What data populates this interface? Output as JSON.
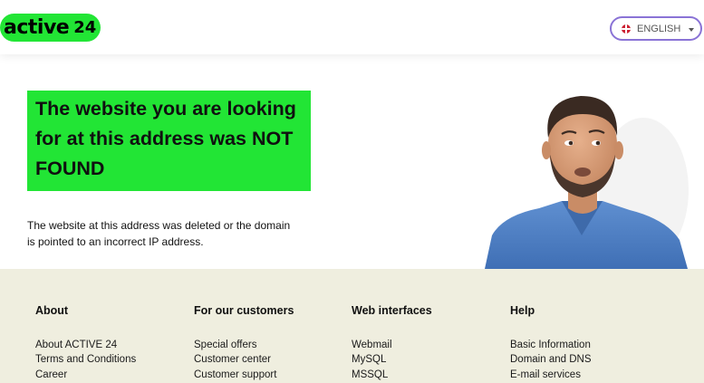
{
  "header": {
    "logo_text": "active",
    "logo_number": "24",
    "language": {
      "selected": "ENGLISH",
      "flag_icon": "uk-flag-icon"
    }
  },
  "main": {
    "title": "The website you are looking for at this address was NOT FOUND",
    "description": "The website at this address was deleted or the domain is pointed to an incorrect IP address."
  },
  "footer": {
    "columns": [
      {
        "heading": "About",
        "links": [
          "About ACTIVE 24",
          "Terms and Conditions",
          "Career"
        ]
      },
      {
        "heading": "For our customers",
        "links": [
          "Special offers",
          "Customer center",
          "Customer support"
        ]
      },
      {
        "heading": "Web interfaces",
        "links": [
          "Webmail",
          "MySQL",
          "MSSQL"
        ]
      },
      {
        "heading": "Help",
        "links": [
          "Basic Information",
          "Domain and DNS",
          "E-mail services"
        ]
      }
    ]
  },
  "colors": {
    "brand_green": "#22e535",
    "footer_bg": "#efeedf",
    "select_border": "#8a73d6"
  }
}
